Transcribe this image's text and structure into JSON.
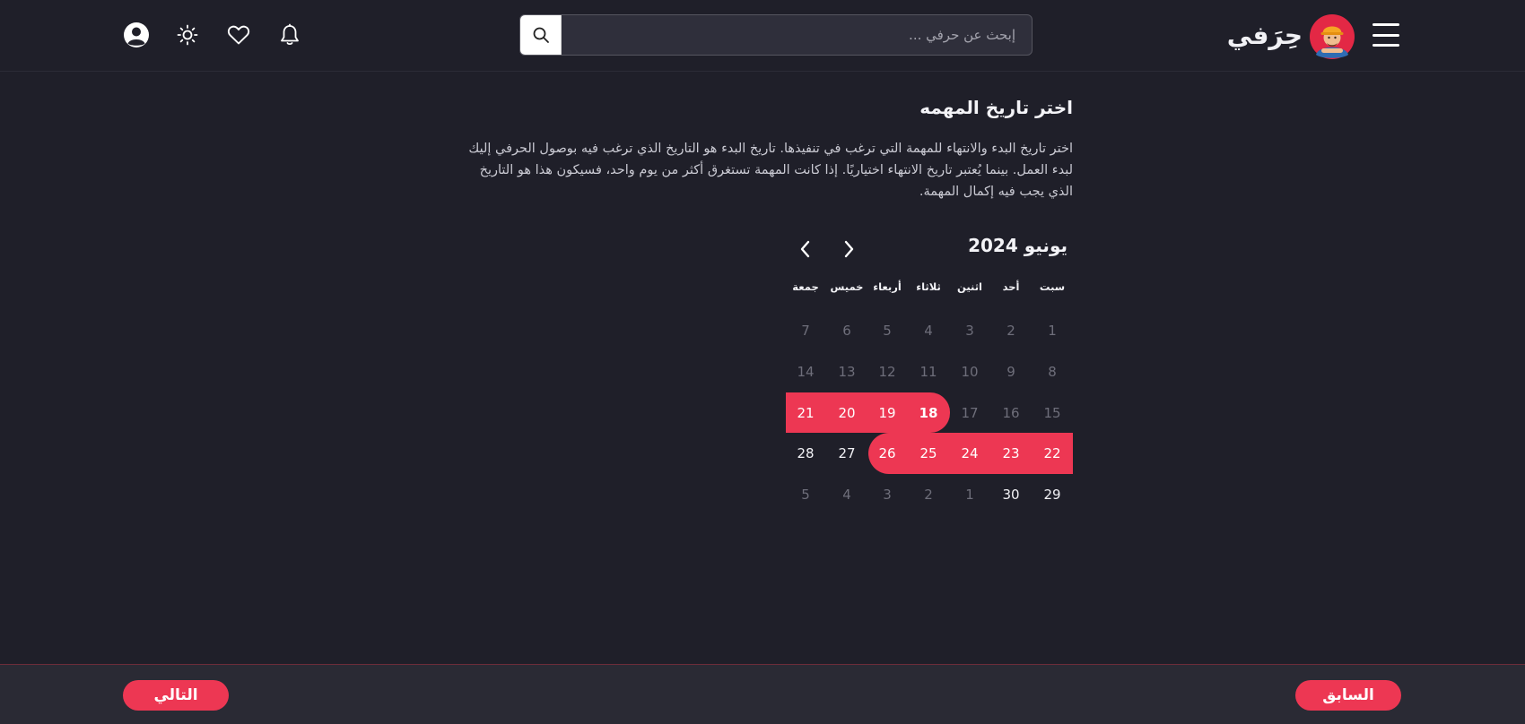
{
  "header": {
    "brand_name": "حِرَفي",
    "search_placeholder": "إبحث عن حرفي ..."
  },
  "page": {
    "title": "اختر تاريخ المهمه",
    "description": "اختر تاريخ البدء والانتهاء للمهمة التي ترغب في تنفيذها. تاريخ البدء هو التاريخ الذي ترغب فيه بوصول الحرفي إليك لبدء العمل. بينما يُعتبر تاريخ الانتهاء اختياريًا. إذا كانت المهمة تستغرق أكثر من يوم واحد، فسيكون هذا هو التاريخ الذي يجب فيه إكمال المهمة."
  },
  "calendar": {
    "month_label": "يونيو 2024",
    "weekdays": [
      "سبت",
      "أحد",
      "اثنين",
      "ثلاثاء",
      "أربعاء",
      "خميس",
      "جمعة"
    ],
    "weeks": [
      [
        {
          "label": "1",
          "state": "other"
        },
        {
          "label": "2",
          "state": "other"
        },
        {
          "label": "3",
          "state": "other"
        },
        {
          "label": "4",
          "state": "other"
        },
        {
          "label": "5",
          "state": "other"
        },
        {
          "label": "6",
          "state": "other"
        },
        {
          "label": "7",
          "state": "other"
        }
      ],
      [
        {
          "label": "8",
          "state": "other"
        },
        {
          "label": "9",
          "state": "other"
        },
        {
          "label": "10",
          "state": "other"
        },
        {
          "label": "11",
          "state": "other"
        },
        {
          "label": "12",
          "state": "other"
        },
        {
          "label": "13",
          "state": "other"
        },
        {
          "label": "14",
          "state": "other"
        }
      ],
      [
        {
          "label": "15",
          "state": "other"
        },
        {
          "label": "16",
          "state": "other"
        },
        {
          "label": "17",
          "state": "other"
        },
        {
          "label": "18",
          "state": "start"
        },
        {
          "label": "19",
          "state": "range"
        },
        {
          "label": "20",
          "state": "range"
        },
        {
          "label": "21",
          "state": "range"
        }
      ],
      [
        {
          "label": "22",
          "state": "range"
        },
        {
          "label": "23",
          "state": "range"
        },
        {
          "label": "24",
          "state": "range"
        },
        {
          "label": "25",
          "state": "range"
        },
        {
          "label": "26",
          "state": "end"
        },
        {
          "label": "27",
          "state": "current"
        },
        {
          "label": "28",
          "state": "current"
        }
      ],
      [
        {
          "label": "29",
          "state": "current"
        },
        {
          "label": "30",
          "state": "current"
        },
        {
          "label": "1",
          "state": "other"
        },
        {
          "label": "2",
          "state": "other"
        },
        {
          "label": "3",
          "state": "other"
        },
        {
          "label": "4",
          "state": "other"
        },
        {
          "label": "5",
          "state": "other"
        }
      ]
    ]
  },
  "footer": {
    "previous_label": "السابق",
    "next_label": "التالي"
  },
  "colors": {
    "accent": "#ed3753",
    "background": "#1f1f29",
    "footer": "#2a2a34"
  },
  "icons": [
    "profile-icon",
    "sun-icon",
    "heart-icon",
    "bell-icon",
    "search-icon",
    "menu-icon",
    "chevron-left-icon",
    "chevron-right-icon"
  ]
}
